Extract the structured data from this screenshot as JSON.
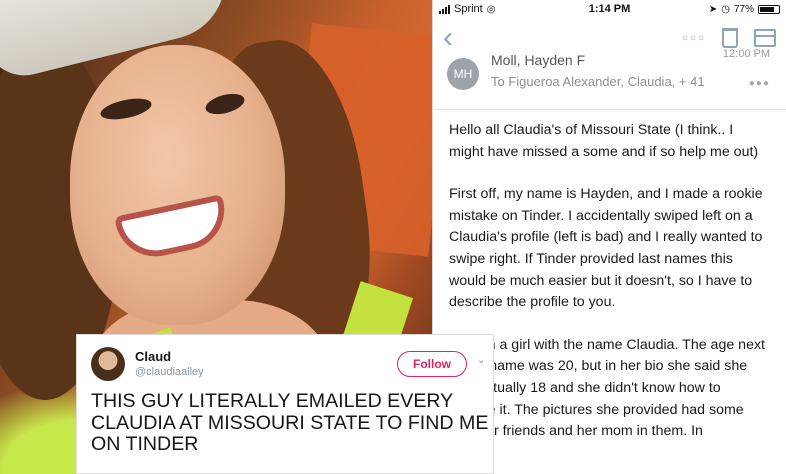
{
  "status_bar": {
    "carrier": "Sprint",
    "time": "1:14 PM",
    "battery": "77%"
  },
  "email": {
    "avatar_initials": "MH",
    "sender": "Moll, Hayden F",
    "sent_time": "12:00 PM",
    "recipients": "To Figueroa Alexander, Claudia, + 41",
    "paragraphs": [
      "Hello all Claudia's of Missouri State (I think.. I might have missed a some and if so help me out)",
      "First off, my name is Hayden, and I made a rookie mistake on Tinder. I accidentally swiped left on a Claudia's profile (left is bad) and I really wanted to swipe right. If Tinder provided last names this would be much easier but it doesn't, so I have to describe the profile to you.",
      "I left on a girl with the name Claudia. The age next to her name was 20, but in her bio she said she was actually 18 and she didn't know how to change it. The pictures she provided had some with her friends and her mom in them. In"
    ]
  },
  "tweet": {
    "name": "Claud",
    "handle": "@claudiaalley",
    "follow_label": "Follow",
    "text": "THIS GUY LITERALLY EMAILED EVERY CLAUDIA AT MISSOURI STATE TO FIND ME ON TINDER"
  },
  "colors": {
    "ios_tint": "#8ea3b8",
    "follow_accent": "#e0245e",
    "tank_top": "#c3e23f"
  }
}
